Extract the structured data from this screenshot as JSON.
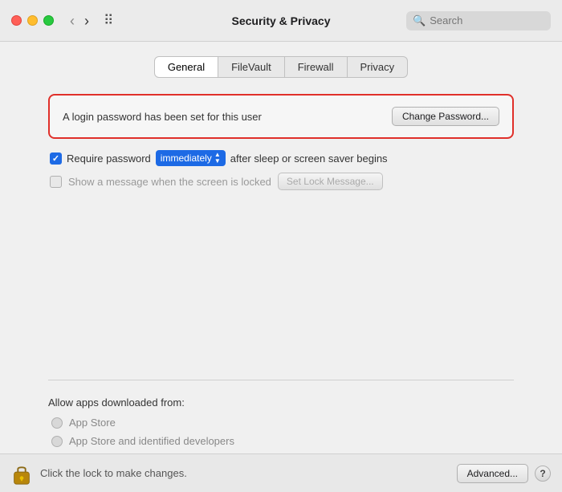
{
  "titlebar": {
    "title": "Security & Privacy",
    "back_button": "‹",
    "forward_button": "›",
    "search_placeholder": "Search"
  },
  "tabs": [
    {
      "id": "general",
      "label": "General",
      "active": true
    },
    {
      "id": "filevault",
      "label": "FileVault",
      "active": false
    },
    {
      "id": "firewall",
      "label": "Firewall",
      "active": false
    },
    {
      "id": "privacy",
      "label": "Privacy",
      "active": false
    }
  ],
  "password_section": {
    "info_text": "A login password has been set for this user",
    "change_button": "Change Password..."
  },
  "require_password": {
    "label": "Require password",
    "dropdown_value": "immediately",
    "after_text": "after sleep or screen saver begins"
  },
  "show_message": {
    "label": "Show a message when the screen is locked",
    "button": "Set Lock Message..."
  },
  "allow_apps": {
    "title": "Allow apps downloaded from:",
    "options": [
      {
        "label": "App Store"
      },
      {
        "label": "App Store and identified developers"
      }
    ]
  },
  "bottombar": {
    "lock_label": "Click the lock to make changes.",
    "advanced_button": "Advanced...",
    "help_button": "?"
  }
}
